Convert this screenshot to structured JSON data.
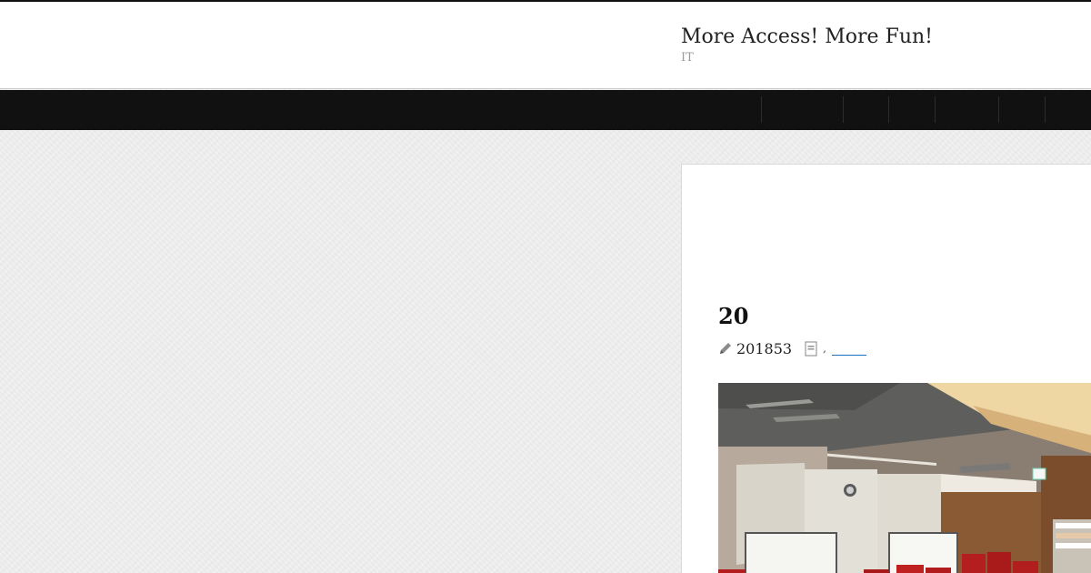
{
  "site": {
    "title": "More Access! More Fun!",
    "description": "IT"
  },
  "nav": {
    "items": [
      "",
      "",
      "",
      "",
      "",
      ""
    ]
  },
  "post": {
    "title": "20",
    "date": "201853",
    "separator": ",",
    "category": ""
  },
  "icons": {
    "date": "pencil-icon",
    "category": "document-icon"
  },
  "colors": {
    "nav_background": "#111111",
    "link": "#1a6fc2",
    "title": "#222222",
    "description": "#9a9a9a"
  }
}
